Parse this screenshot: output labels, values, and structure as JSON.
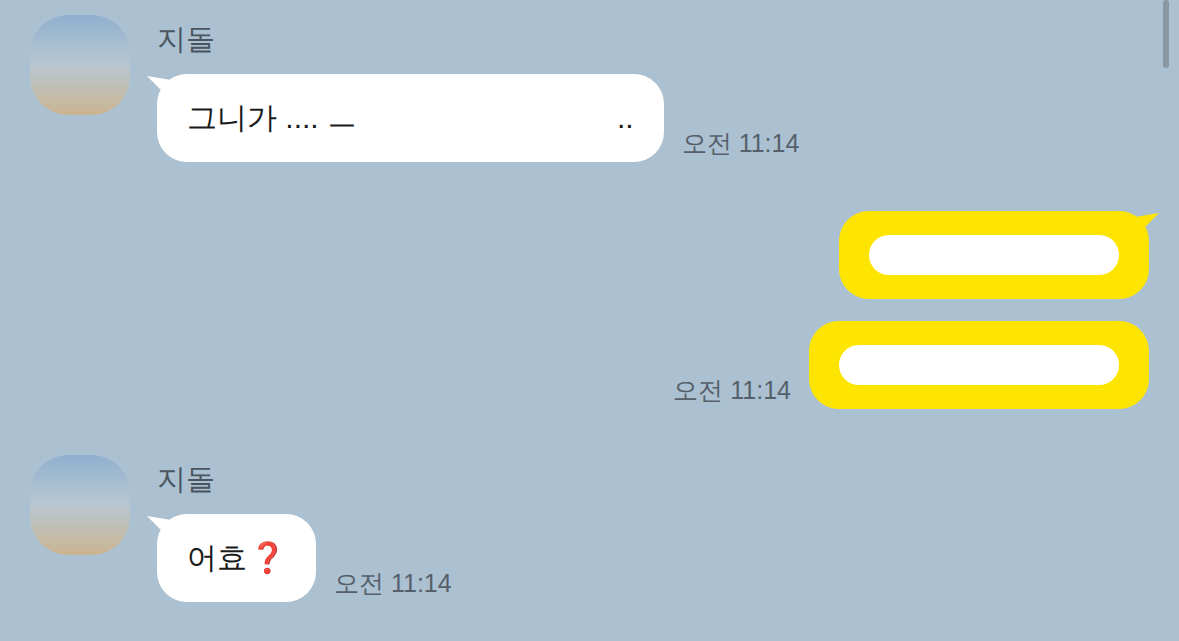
{
  "messages": [
    {
      "direction": "incoming",
      "sender": "지돌",
      "show_profile": true,
      "segments": [
        {
          "text": "그니가 .... ㅡ"
        },
        {
          "redacted": true
        },
        {
          "text": ".."
        }
      ],
      "time": "오전 11:14"
    },
    {
      "direction": "outgoing",
      "show_profile": false,
      "segments": [
        {
          "redacted": true
        }
      ]
    },
    {
      "direction": "outgoing",
      "show_profile": false,
      "segments": [
        {
          "redacted": true
        }
      ],
      "time": "오전 11:14"
    },
    {
      "direction": "incoming",
      "sender": "지돌",
      "show_profile": true,
      "segments": [
        {
          "text": "어효"
        },
        {
          "text": "❓",
          "emoji": true
        }
      ],
      "time": "오전 11:14"
    }
  ]
}
